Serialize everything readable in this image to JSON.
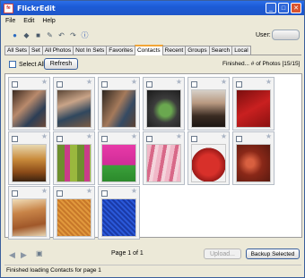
{
  "window": {
    "title": "FlickrEdit",
    "minimize": "_",
    "maximize": "□",
    "close": "✕"
  },
  "menu": [
    "File",
    "Edit",
    "Help"
  ],
  "toolbar": {
    "icons": [
      "earth-icon",
      "tag-icon",
      "page-icon",
      "edit-icon",
      "undo-icon",
      "redo-icon",
      "info-icon"
    ],
    "user_label": "User:"
  },
  "tabs": [
    "All Sets",
    "Set",
    "All Photos",
    "Not In Sets",
    "Favorites",
    "Contacts",
    "Recent",
    "Groups",
    "Search",
    "Local"
  ],
  "active_tab": "Contacts",
  "controls": {
    "select_all_label": "Select All",
    "refresh_label": "Refresh",
    "status_text": "Finished... # of Photos [15/15]"
  },
  "photos": [
    {
      "name": "photo-1"
    },
    {
      "name": "photo-2"
    },
    {
      "name": "photo-3"
    },
    {
      "name": "photo-4"
    },
    {
      "name": "photo-5"
    },
    {
      "name": "photo-6"
    },
    {
      "name": "photo-7"
    },
    {
      "name": "photo-8"
    },
    {
      "name": "photo-9"
    },
    {
      "name": "photo-10"
    },
    {
      "name": "photo-11"
    },
    {
      "name": "photo-12"
    },
    {
      "name": "photo-13"
    },
    {
      "name": "photo-14"
    },
    {
      "name": "photo-15"
    }
  ],
  "footer": {
    "page_label": "Page 1 of 1",
    "upload_label": "Upload...",
    "backup_label": "Backup Selected"
  },
  "statusbar": {
    "text": "Finished loading Contacts for page 1"
  },
  "colors": {
    "titlebar": "#1f56c8",
    "active_tab_accent": "#f2a637",
    "window_bg": "#ece9d8"
  }
}
